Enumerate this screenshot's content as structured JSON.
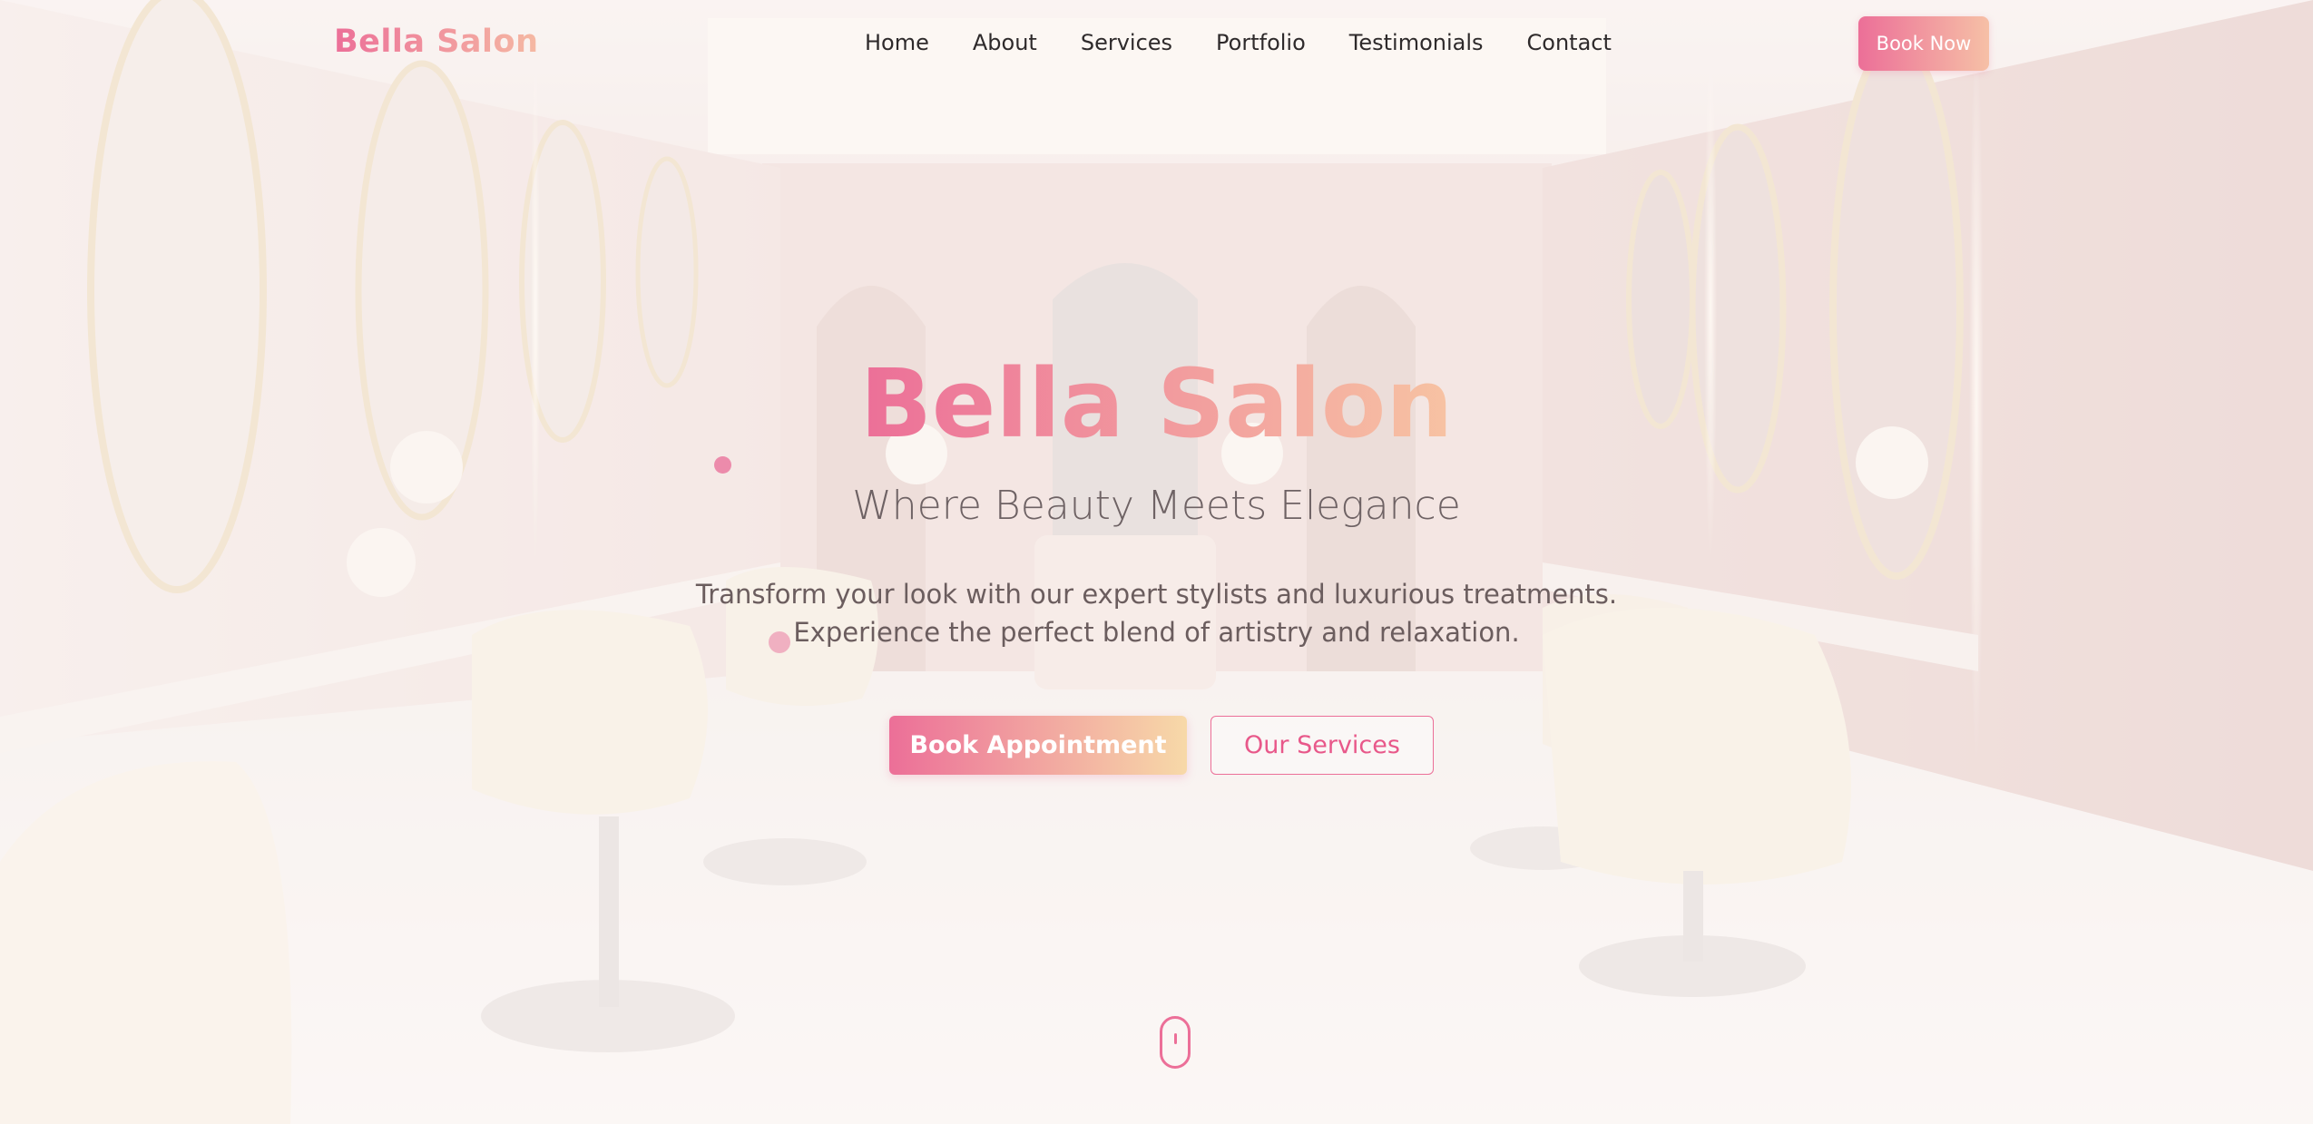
{
  "brand": {
    "name": "Bella Salon"
  },
  "nav": {
    "links": [
      "Home",
      "About",
      "Services",
      "Portfolio",
      "Testimonials",
      "Contact"
    ],
    "cta_label": "Book Now"
  },
  "hero": {
    "title": "Bella Salon",
    "subtitle": "Where Beauty Meets Elegance",
    "description_line1": "Transform your look with our expert stylists and luxurious treatments.",
    "description_line2": "Experience the perfect blend of artistry and relaxation.",
    "primary_button": "Book Appointment",
    "secondary_button": "Our Services"
  },
  "icons": {
    "scroll": "mouse-scroll-icon"
  },
  "colors": {
    "accent_pink": "#ec6f98",
    "accent_peach": "#f7c3a3",
    "text_dark": "#2e2a2b",
    "text_muted": "#6b5d5e"
  }
}
